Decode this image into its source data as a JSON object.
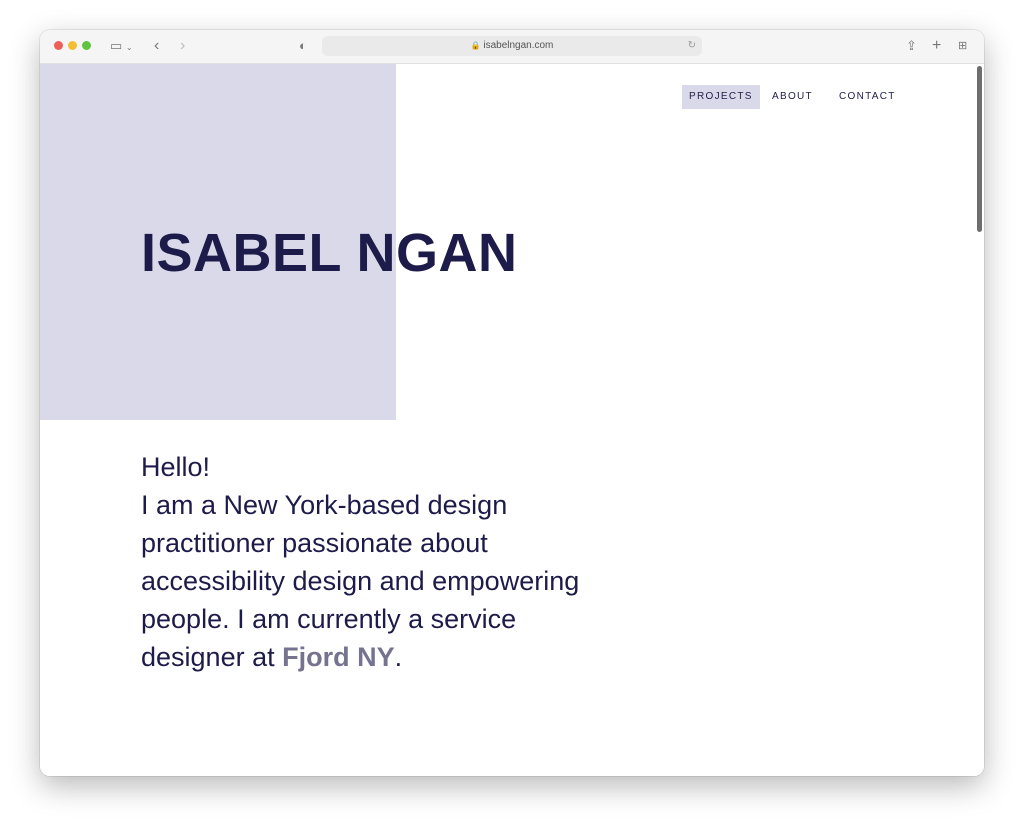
{
  "browser": {
    "url": "isabelngan.com",
    "icons": [
      "sidebar-icon",
      "back-icon",
      "forward-icon",
      "shield-icon",
      "lock-icon",
      "reload-icon",
      "share-icon",
      "new-tab-icon",
      "tab-overview-icon"
    ]
  },
  "nav": {
    "items": [
      {
        "label": "PROJECTS",
        "active": true
      },
      {
        "label": "ABOUT"
      },
      {
        "label": "CONTACT"
      }
    ]
  },
  "hero": {
    "title": "ISABEL NGAN"
  },
  "intro": {
    "greeting": "Hello!",
    "text": "I am a New York-based design practitioner passionate about accessibility design and empowering people. I am currently a service designer at ",
    "link": "Fjord NY",
    "end": "."
  },
  "colors": {
    "accent": "#dad9ea",
    "text": "#1d1b4a",
    "link": "#75738f"
  }
}
